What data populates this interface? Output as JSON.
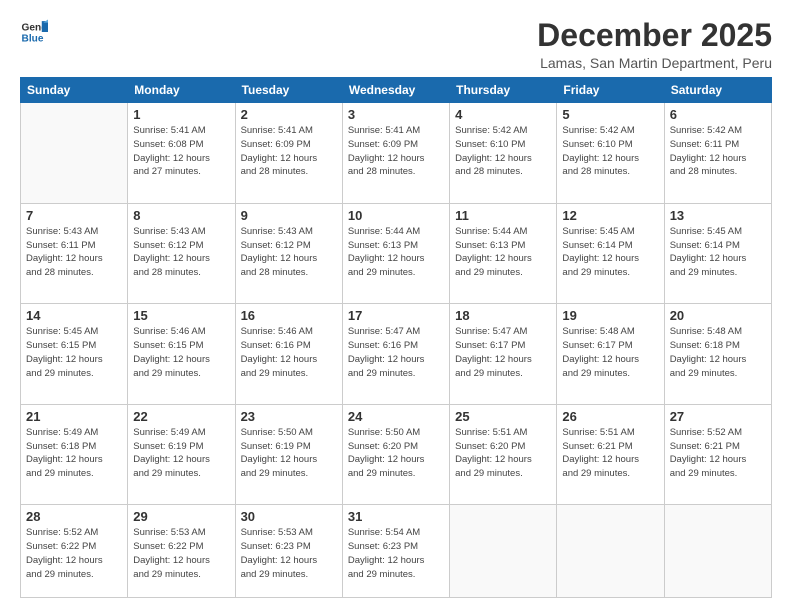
{
  "logo": {
    "line1": "General",
    "line2": "Blue"
  },
  "title": "December 2025",
  "subtitle": "Lamas, San Martin Department, Peru",
  "days_header": [
    "Sunday",
    "Monday",
    "Tuesday",
    "Wednesday",
    "Thursday",
    "Friday",
    "Saturday"
  ],
  "weeks": [
    [
      {
        "day": "",
        "info": ""
      },
      {
        "day": "1",
        "info": "Sunrise: 5:41 AM\nSunset: 6:08 PM\nDaylight: 12 hours\nand 27 minutes."
      },
      {
        "day": "2",
        "info": "Sunrise: 5:41 AM\nSunset: 6:09 PM\nDaylight: 12 hours\nand 28 minutes."
      },
      {
        "day": "3",
        "info": "Sunrise: 5:41 AM\nSunset: 6:09 PM\nDaylight: 12 hours\nand 28 minutes."
      },
      {
        "day": "4",
        "info": "Sunrise: 5:42 AM\nSunset: 6:10 PM\nDaylight: 12 hours\nand 28 minutes."
      },
      {
        "day": "5",
        "info": "Sunrise: 5:42 AM\nSunset: 6:10 PM\nDaylight: 12 hours\nand 28 minutes."
      },
      {
        "day": "6",
        "info": "Sunrise: 5:42 AM\nSunset: 6:11 PM\nDaylight: 12 hours\nand 28 minutes."
      }
    ],
    [
      {
        "day": "7",
        "info": "Sunrise: 5:43 AM\nSunset: 6:11 PM\nDaylight: 12 hours\nand 28 minutes."
      },
      {
        "day": "8",
        "info": "Sunrise: 5:43 AM\nSunset: 6:12 PM\nDaylight: 12 hours\nand 28 minutes."
      },
      {
        "day": "9",
        "info": "Sunrise: 5:43 AM\nSunset: 6:12 PM\nDaylight: 12 hours\nand 28 minutes."
      },
      {
        "day": "10",
        "info": "Sunrise: 5:44 AM\nSunset: 6:13 PM\nDaylight: 12 hours\nand 29 minutes."
      },
      {
        "day": "11",
        "info": "Sunrise: 5:44 AM\nSunset: 6:13 PM\nDaylight: 12 hours\nand 29 minutes."
      },
      {
        "day": "12",
        "info": "Sunrise: 5:45 AM\nSunset: 6:14 PM\nDaylight: 12 hours\nand 29 minutes."
      },
      {
        "day": "13",
        "info": "Sunrise: 5:45 AM\nSunset: 6:14 PM\nDaylight: 12 hours\nand 29 minutes."
      }
    ],
    [
      {
        "day": "14",
        "info": "Sunrise: 5:45 AM\nSunset: 6:15 PM\nDaylight: 12 hours\nand 29 minutes."
      },
      {
        "day": "15",
        "info": "Sunrise: 5:46 AM\nSunset: 6:15 PM\nDaylight: 12 hours\nand 29 minutes."
      },
      {
        "day": "16",
        "info": "Sunrise: 5:46 AM\nSunset: 6:16 PM\nDaylight: 12 hours\nand 29 minutes."
      },
      {
        "day": "17",
        "info": "Sunrise: 5:47 AM\nSunset: 6:16 PM\nDaylight: 12 hours\nand 29 minutes."
      },
      {
        "day": "18",
        "info": "Sunrise: 5:47 AM\nSunset: 6:17 PM\nDaylight: 12 hours\nand 29 minutes."
      },
      {
        "day": "19",
        "info": "Sunrise: 5:48 AM\nSunset: 6:17 PM\nDaylight: 12 hours\nand 29 minutes."
      },
      {
        "day": "20",
        "info": "Sunrise: 5:48 AM\nSunset: 6:18 PM\nDaylight: 12 hours\nand 29 minutes."
      }
    ],
    [
      {
        "day": "21",
        "info": "Sunrise: 5:49 AM\nSunset: 6:18 PM\nDaylight: 12 hours\nand 29 minutes."
      },
      {
        "day": "22",
        "info": "Sunrise: 5:49 AM\nSunset: 6:19 PM\nDaylight: 12 hours\nand 29 minutes."
      },
      {
        "day": "23",
        "info": "Sunrise: 5:50 AM\nSunset: 6:19 PM\nDaylight: 12 hours\nand 29 minutes."
      },
      {
        "day": "24",
        "info": "Sunrise: 5:50 AM\nSunset: 6:20 PM\nDaylight: 12 hours\nand 29 minutes."
      },
      {
        "day": "25",
        "info": "Sunrise: 5:51 AM\nSunset: 6:20 PM\nDaylight: 12 hours\nand 29 minutes."
      },
      {
        "day": "26",
        "info": "Sunrise: 5:51 AM\nSunset: 6:21 PM\nDaylight: 12 hours\nand 29 minutes."
      },
      {
        "day": "27",
        "info": "Sunrise: 5:52 AM\nSunset: 6:21 PM\nDaylight: 12 hours\nand 29 minutes."
      }
    ],
    [
      {
        "day": "28",
        "info": "Sunrise: 5:52 AM\nSunset: 6:22 PM\nDaylight: 12 hours\nand 29 minutes."
      },
      {
        "day": "29",
        "info": "Sunrise: 5:53 AM\nSunset: 6:22 PM\nDaylight: 12 hours\nand 29 minutes."
      },
      {
        "day": "30",
        "info": "Sunrise: 5:53 AM\nSunset: 6:23 PM\nDaylight: 12 hours\nand 29 minutes."
      },
      {
        "day": "31",
        "info": "Sunrise: 5:54 AM\nSunset: 6:23 PM\nDaylight: 12 hours\nand 29 minutes."
      },
      {
        "day": "",
        "info": ""
      },
      {
        "day": "",
        "info": ""
      },
      {
        "day": "",
        "info": ""
      }
    ]
  ]
}
